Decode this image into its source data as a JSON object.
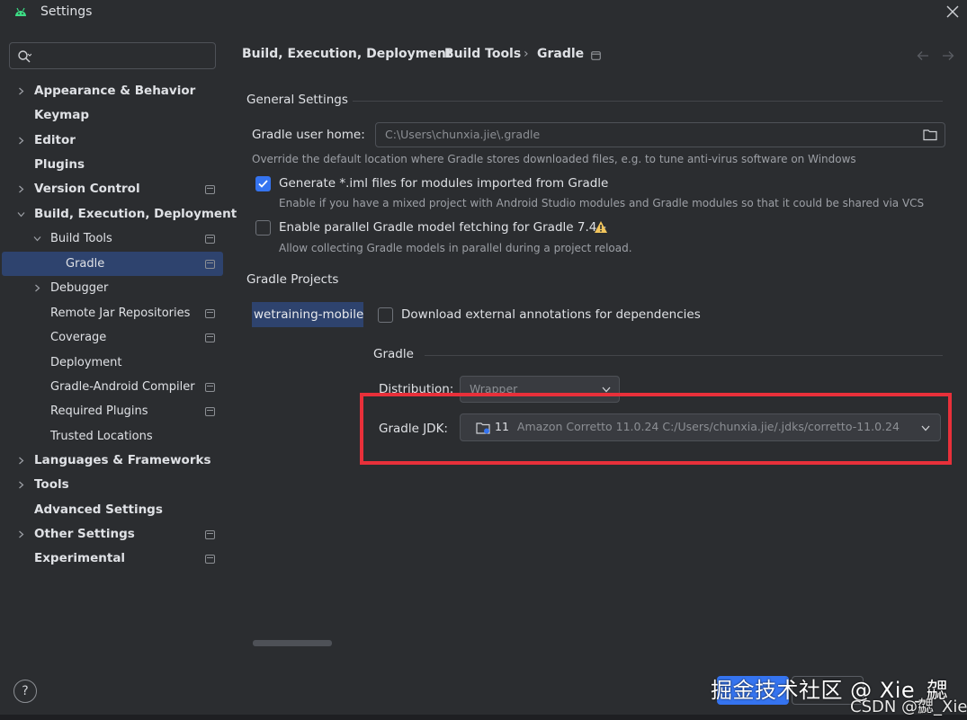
{
  "window": {
    "title": "Settings"
  },
  "search": {
    "placeholder": ""
  },
  "sidebar": {
    "items": [
      {
        "label": "Appearance & Behavior"
      },
      {
        "label": "Keymap"
      },
      {
        "label": "Editor"
      },
      {
        "label": "Plugins"
      },
      {
        "label": "Version Control"
      },
      {
        "label": "Build, Execution, Deployment"
      },
      {
        "label": "Build Tools"
      },
      {
        "label": "Gradle"
      },
      {
        "label": "Debugger"
      },
      {
        "label": "Remote Jar Repositories"
      },
      {
        "label": "Coverage"
      },
      {
        "label": "Deployment"
      },
      {
        "label": "Gradle-Android Compiler"
      },
      {
        "label": "Required Plugins"
      },
      {
        "label": "Trusted Locations"
      },
      {
        "label": "Languages & Frameworks"
      },
      {
        "label": "Tools"
      },
      {
        "label": "Advanced Settings"
      },
      {
        "label": "Other Settings"
      },
      {
        "label": "Experimental"
      }
    ],
    "help_label": "?"
  },
  "breadcrumb": {
    "items": [
      "Build, Execution, Deployment",
      "Build Tools",
      "Gradle"
    ],
    "separator": "›"
  },
  "general": {
    "title": "General Settings",
    "user_home_label": "Gradle user home:",
    "user_home_value": "C:\\Users\\chunxia.jie\\.gradle",
    "user_home_hint": "Override the default location where Gradle stores downloaded files, e.g. to tune anti-virus software on Windows",
    "iml_label": "Generate *.iml files for modules imported from Gradle",
    "iml_hint": "Enable if you have a mixed project with Android Studio modules and Gradle modules so that it could be shared via VCS",
    "iml_checked": true,
    "parallel_label": "Enable parallel Gradle model fetching for Gradle 7.4+",
    "parallel_hint": "Allow collecting Gradle models in parallel during a project reload.",
    "parallel_checked": false
  },
  "projects": {
    "title": "Gradle Projects",
    "selected_project": "wetraining-mobileT",
    "annotations_label": "Download external annotations for dependencies",
    "annotations_checked": false
  },
  "gradle": {
    "title": "Gradle",
    "distribution_label": "Distribution:",
    "distribution_value": "Wrapper",
    "jdk_label": "Gradle JDK:",
    "jdk_version": "11",
    "jdk_value": "Amazon Corretto 11.0.24 C:/Users/chunxia.jie/.jdks/corretto-11.0.24"
  },
  "watermark": {
    "line1": "掘金技术社区 @ Xie_勰",
    "line2": "CSDN @勰_Xie"
  },
  "colors": {
    "background": "#2b2d30",
    "selection": "#2e436e",
    "accent": "#3574f0",
    "highlight_box": "#e8303a",
    "warning": "#f2c55c"
  }
}
